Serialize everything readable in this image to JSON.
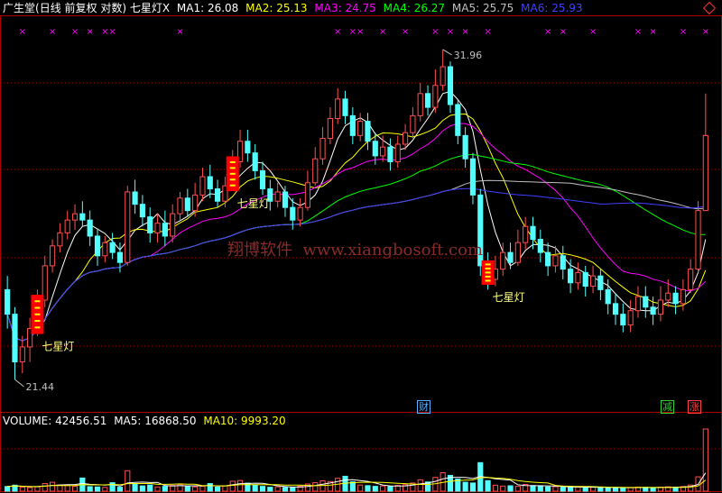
{
  "header": {
    "stock_name": "广生堂",
    "period_info": "(日线 前复权 对数)",
    "indicator_name": "七星灯X",
    "ma1": "MA1: 26.08",
    "ma2": "MA2: 25.13",
    "ma3": "MA3: 24.75",
    "ma4": "MA4: 26.27",
    "ma5": "MA5: 25.75",
    "ma6": "MA6: 25.93"
  },
  "volume_header": {
    "volume": "VOLUME: 42456.51",
    "ma5": "MA5: 16868.50",
    "ma10": "MA10: 9993.20"
  },
  "annotations": {
    "high_price": "31.96",
    "low_price": "21.44",
    "signal_label": "七星灯",
    "cross_mark": "×",
    "watermark": "翔博软件  www.xiangbosoft.com",
    "badge_finance": "财",
    "badge_reduce": "减",
    "badge_up": "涨"
  },
  "colors": {
    "background": "#000000",
    "up_candle": "#ff5050",
    "down_candle": "#54ffff",
    "ma1": "#ffffff",
    "ma2": "#ffff00",
    "ma3": "#ff00ff",
    "ma4": "#00ff00",
    "ma5": "#c0c0c0",
    "ma6": "#4040ff",
    "grid": "#aa0000",
    "signal_box": "#ff0000",
    "marker": "#ff00ff",
    "watermark": "#8a2a2a"
  },
  "chart_data": {
    "type": "candlestick",
    "price_range": [
      21.0,
      33.2
    ],
    "price_scale": "log",
    "high": 31.96,
    "low": 21.44,
    "candles": [
      {
        "o": 23.9,
        "c": 23.2,
        "h": 24.3,
        "l": 22.8
      },
      {
        "o": 23.2,
        "c": 21.9,
        "h": 23.4,
        "l": 21.44
      },
      {
        "o": 21.9,
        "c": 22.3,
        "h": 22.6,
        "l": 21.6
      },
      {
        "o": 22.3,
        "c": 22.8,
        "h": 23.1,
        "l": 21.9
      },
      {
        "o": 22.8,
        "c": 23.6,
        "h": 23.9,
        "l": 22.6
      },
      {
        "o": 23.6,
        "c": 24.6,
        "h": 24.9,
        "l": 23.4
      },
      {
        "o": 24.6,
        "c": 25.2,
        "h": 25.4,
        "l": 24.4
      },
      {
        "o": 25.2,
        "c": 25.6,
        "h": 25.9,
        "l": 25.0
      },
      {
        "o": 25.6,
        "c": 26.0,
        "h": 26.3,
        "l": 25.4
      },
      {
        "o": 26.0,
        "c": 26.2,
        "h": 26.5,
        "l": 25.7
      },
      {
        "o": 26.2,
        "c": 26.0,
        "h": 26.6,
        "l": 25.8
      },
      {
        "o": 26.0,
        "c": 25.5,
        "h": 26.3,
        "l": 25.2
      },
      {
        "o": 25.5,
        "c": 24.9,
        "h": 25.7,
        "l": 24.6
      },
      {
        "o": 24.9,
        "c": 25.3,
        "h": 25.5,
        "l": 24.7
      },
      {
        "o": 25.3,
        "c": 25.0,
        "h": 25.6,
        "l": 24.8
      },
      {
        "o": 25.0,
        "c": 24.7,
        "h": 25.3,
        "l": 24.4
      },
      {
        "o": 24.7,
        "c": 26.9,
        "h": 27.1,
        "l": 24.6
      },
      {
        "o": 26.9,
        "c": 26.5,
        "h": 27.3,
        "l": 26.2
      },
      {
        "o": 26.5,
        "c": 26.1,
        "h": 26.8,
        "l": 25.8
      },
      {
        "o": 26.1,
        "c": 25.6,
        "h": 26.4,
        "l": 25.3
      },
      {
        "o": 25.6,
        "c": 25.9,
        "h": 26.2,
        "l": 25.3
      },
      {
        "o": 25.9,
        "c": 25.5,
        "h": 26.3,
        "l": 25.2
      },
      {
        "o": 25.5,
        "c": 26.2,
        "h": 26.5,
        "l": 25.3
      },
      {
        "o": 26.2,
        "c": 26.7,
        "h": 26.9,
        "l": 26.0
      },
      {
        "o": 26.7,
        "c": 26.3,
        "h": 27.0,
        "l": 26.1
      },
      {
        "o": 26.3,
        "c": 26.8,
        "h": 27.2,
        "l": 26.1
      },
      {
        "o": 26.8,
        "c": 27.4,
        "h": 27.7,
        "l": 26.6
      },
      {
        "o": 27.4,
        "c": 27.0,
        "h": 27.8,
        "l": 26.7
      },
      {
        "o": 27.0,
        "c": 26.6,
        "h": 27.3,
        "l": 26.4
      },
      {
        "o": 26.6,
        "c": 27.1,
        "h": 27.4,
        "l": 26.4
      },
      {
        "o": 27.1,
        "c": 27.9,
        "h": 28.3,
        "l": 27.0
      },
      {
        "o": 27.9,
        "c": 28.6,
        "h": 29.0,
        "l": 27.7
      },
      {
        "o": 28.6,
        "c": 28.2,
        "h": 29.0,
        "l": 27.9
      },
      {
        "o": 28.2,
        "c": 27.6,
        "h": 28.5,
        "l": 27.3
      },
      {
        "o": 27.6,
        "c": 27.0,
        "h": 27.9,
        "l": 26.8
      },
      {
        "o": 27.0,
        "c": 26.6,
        "h": 27.3,
        "l": 26.3
      },
      {
        "o": 26.6,
        "c": 26.9,
        "h": 27.2,
        "l": 26.4
      },
      {
        "o": 26.9,
        "c": 26.4,
        "h": 27.1,
        "l": 26.1
      },
      {
        "o": 26.4,
        "c": 26.0,
        "h": 26.7,
        "l": 25.7
      },
      {
        "o": 26.0,
        "c": 26.4,
        "h": 26.7,
        "l": 25.8
      },
      {
        "o": 26.4,
        "c": 27.2,
        "h": 27.6,
        "l": 26.3
      },
      {
        "o": 27.2,
        "c": 28.0,
        "h": 28.4,
        "l": 27.1
      },
      {
        "o": 28.0,
        "c": 28.7,
        "h": 29.1,
        "l": 27.8
      },
      {
        "o": 28.7,
        "c": 29.4,
        "h": 29.8,
        "l": 28.5
      },
      {
        "o": 29.4,
        "c": 30.1,
        "h": 30.5,
        "l": 29.2
      },
      {
        "o": 30.1,
        "c": 29.5,
        "h": 30.4,
        "l": 29.2
      },
      {
        "o": 29.5,
        "c": 28.8,
        "h": 29.8,
        "l": 28.5
      },
      {
        "o": 28.8,
        "c": 29.3,
        "h": 29.6,
        "l": 28.6
      },
      {
        "o": 29.3,
        "c": 28.6,
        "h": 29.6,
        "l": 28.3
      },
      {
        "o": 28.6,
        "c": 28.1,
        "h": 28.9,
        "l": 27.8
      },
      {
        "o": 28.1,
        "c": 28.4,
        "h": 28.8,
        "l": 27.9
      },
      {
        "o": 28.4,
        "c": 27.9,
        "h": 28.7,
        "l": 27.6
      },
      {
        "o": 27.9,
        "c": 28.5,
        "h": 28.8,
        "l": 27.7
      },
      {
        "o": 28.5,
        "c": 28.9,
        "h": 29.2,
        "l": 28.3
      },
      {
        "o": 28.9,
        "c": 29.5,
        "h": 29.8,
        "l": 28.7
      },
      {
        "o": 29.5,
        "c": 30.3,
        "h": 30.7,
        "l": 29.3
      },
      {
        "o": 30.3,
        "c": 29.8,
        "h": 30.6,
        "l": 29.5
      },
      {
        "o": 29.8,
        "c": 30.6,
        "h": 31.2,
        "l": 29.6
      },
      {
        "o": 30.6,
        "c": 31.3,
        "h": 31.96,
        "l": 30.4
      },
      {
        "o": 31.3,
        "c": 29.9,
        "h": 31.5,
        "l": 29.6
      },
      {
        "o": 29.9,
        "c": 28.8,
        "h": 30.1,
        "l": 28.5
      },
      {
        "o": 28.8,
        "c": 28.0,
        "h": 29.1,
        "l": 27.7
      },
      {
        "o": 28.0,
        "c": 26.8,
        "h": 28.2,
        "l": 26.5
      },
      {
        "o": 26.8,
        "c": 24.6,
        "h": 27.0,
        "l": 24.3
      },
      {
        "o": 24.6,
        "c": 24.2,
        "h": 25.0,
        "l": 23.9
      },
      {
        "o": 24.2,
        "c": 24.5,
        "h": 24.9,
        "l": 24.0
      },
      {
        "o": 24.5,
        "c": 25.0,
        "h": 25.3,
        "l": 24.3
      },
      {
        "o": 25.0,
        "c": 24.7,
        "h": 25.3,
        "l": 24.5
      },
      {
        "o": 24.7,
        "c": 25.3,
        "h": 25.7,
        "l": 24.6
      },
      {
        "o": 25.3,
        "c": 25.8,
        "h": 26.1,
        "l": 25.1
      },
      {
        "o": 25.8,
        "c": 25.4,
        "h": 26.1,
        "l": 25.1
      },
      {
        "o": 25.4,
        "c": 25.0,
        "h": 25.7,
        "l": 24.7
      },
      {
        "o": 25.0,
        "c": 24.6,
        "h": 25.3,
        "l": 24.3
      },
      {
        "o": 24.6,
        "c": 24.9,
        "h": 25.2,
        "l": 24.4
      },
      {
        "o": 24.9,
        "c": 24.5,
        "h": 25.2,
        "l": 24.2
      },
      {
        "o": 24.5,
        "c": 24.1,
        "h": 24.8,
        "l": 23.8
      },
      {
        "o": 24.1,
        "c": 24.4,
        "h": 24.7,
        "l": 23.9
      },
      {
        "o": 24.4,
        "c": 24.0,
        "h": 24.6,
        "l": 23.7
      },
      {
        "o": 24.0,
        "c": 24.3,
        "h": 24.6,
        "l": 23.8
      },
      {
        "o": 24.3,
        "c": 23.9,
        "h": 24.5,
        "l": 23.6
      },
      {
        "o": 23.9,
        "c": 23.5,
        "h": 24.2,
        "l": 23.2
      },
      {
        "o": 23.5,
        "c": 23.2,
        "h": 23.8,
        "l": 22.9
      },
      {
        "o": 23.2,
        "c": 22.9,
        "h": 23.5,
        "l": 22.7
      },
      {
        "o": 22.9,
        "c": 23.3,
        "h": 23.6,
        "l": 22.7
      },
      {
        "o": 23.3,
        "c": 23.7,
        "h": 24.0,
        "l": 23.1
      },
      {
        "o": 23.7,
        "c": 23.4,
        "h": 24.0,
        "l": 23.1
      },
      {
        "o": 23.4,
        "c": 23.2,
        "h": 23.7,
        "l": 22.9
      },
      {
        "o": 23.2,
        "c": 23.6,
        "h": 24.0,
        "l": 23.0
      },
      {
        "o": 23.6,
        "c": 23.8,
        "h": 24.2,
        "l": 23.4
      },
      {
        "o": 23.8,
        "c": 23.5,
        "h": 24.0,
        "l": 23.2
      },
      {
        "o": 23.5,
        "c": 23.9,
        "h": 24.2,
        "l": 23.3
      },
      {
        "o": 23.9,
        "c": 24.5,
        "h": 24.8,
        "l": 23.8
      },
      {
        "o": 24.5,
        "c": 26.3,
        "h": 26.6,
        "l": 24.4
      },
      {
        "o": 26.3,
        "c": 28.8,
        "h": 30.3,
        "l": 28.2
      }
    ],
    "signals": [
      {
        "index": 4,
        "label": "七星灯"
      },
      {
        "index": 30,
        "label": "七星灯"
      },
      {
        "index": 64,
        "label": "七星灯"
      }
    ],
    "volume_range": [
      0,
      42456.51
    ],
    "volume": [
      3200,
      4100,
      2800,
      2500,
      3000,
      5200,
      6100,
      4300,
      3800,
      3300,
      9000,
      3100,
      2900,
      2600,
      5800,
      2700,
      14000,
      5000,
      3600,
      4200,
      2900,
      3300,
      3900,
      4700,
      3500,
      3000,
      3400,
      5200,
      2800,
      3600,
      6800,
      7300,
      5500,
      4100,
      3300,
      2700,
      3000,
      2600,
      2400,
      3500,
      4900,
      5800,
      7100,
      6600,
      8800,
      10200,
      6400,
      4200,
      3800,
      3300,
      3600,
      3100,
      3900,
      4400,
      5600,
      7800,
      6300,
      9400,
      12600,
      10800,
      8300,
      6100,
      5600,
      19500,
      7200,
      4100,
      3500,
      3700,
      3300,
      4600,
      3800,
      3400,
      2900,
      3100,
      2700,
      2600,
      2800,
      2500,
      2900,
      2600,
      2300,
      2400,
      2200,
      2500,
      2800,
      2600,
      2400,
      2700,
      3000,
      2800,
      3200,
      4200,
      9800,
      42456.51
    ],
    "ma_values": {
      "MA1": 26.08,
      "MA2": 25.13,
      "MA3": 24.75,
      "MA4": 26.27,
      "MA5": 25.75,
      "MA6": 25.93
    }
  }
}
